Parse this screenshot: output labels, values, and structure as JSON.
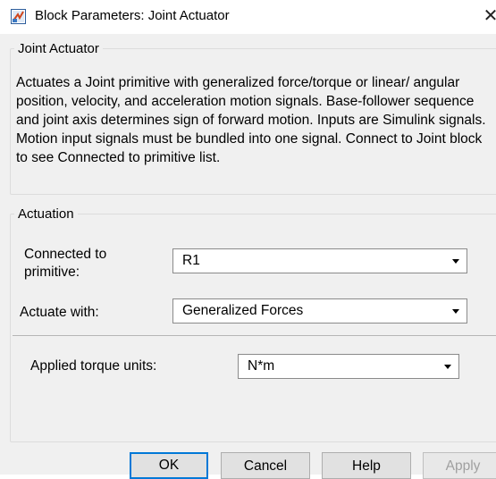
{
  "window": {
    "title": "Block Parameters: Joint Actuator",
    "close_glyph": "✕",
    "icon": "simulink-block-icon"
  },
  "description_group": {
    "legend": "Joint Actuator",
    "text": "Actuates a Joint primitive with generalized force/torque or linear/ angular position, velocity, and acceleration motion signals. Base-follower sequence and joint axis determines sign of forward motion. Inputs are Simulink signals. Motion input signals must be bundled into one signal. Connect to Joint block to see Connected to primitive list."
  },
  "actuation_group": {
    "legend": "Actuation",
    "connected_label": "Connected to primitive:",
    "connected_value": "R1",
    "actuate_label": "Actuate with:",
    "actuate_value": "Generalized Forces",
    "torque_units_label": "Applied torque units:",
    "torque_units_value": "N*m"
  },
  "buttons": {
    "ok": "OK",
    "cancel": "Cancel",
    "help": "Help",
    "apply": "Apply"
  },
  "colors": {
    "default_button_border": "#0078d7",
    "dialog_background": "#f0f0f0"
  }
}
